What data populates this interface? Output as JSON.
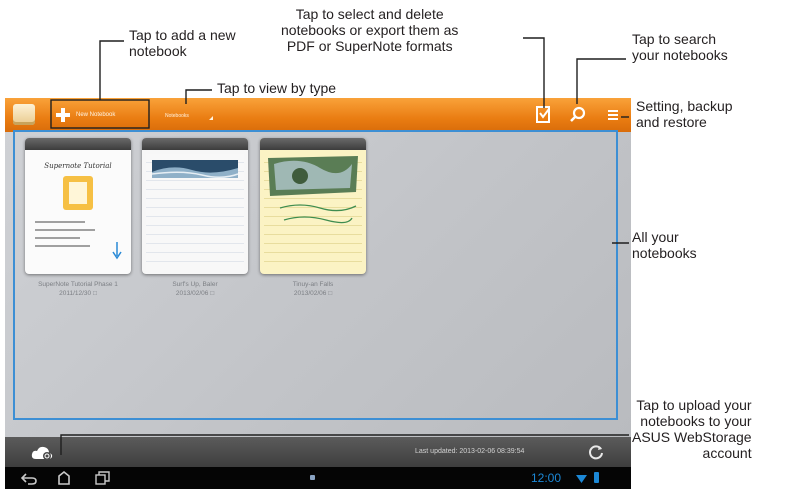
{
  "callouts": {
    "new_notebook": "Tap to add a new\nnotebook",
    "view_type": "Tap to view by type",
    "select_export": "Tap to select and delete\nnotebooks or export them as\nPDF or SuperNote formats",
    "search": "Tap to search\nyour notebooks",
    "settings": "Setting, backup\nand restore",
    "all_notebooks": "All your\nnotebooks",
    "upload": "Tap to upload your\nnotebooks to your\nASUS WebStorage\naccount"
  },
  "toolbar": {
    "new_notebook_label": "New Notebook",
    "view_type_label": "Notebooks",
    "icons": [
      "notebook-app-icon",
      "plus-icon",
      "select-export-icon",
      "search-icon",
      "settings-icon"
    ],
    "accent_color": "#f0860f"
  },
  "notebooks": [
    {
      "title": "SuperNote Tutorial Phase 1",
      "date": "2011/12/30"
    },
    {
      "title": "Surf's Up, Baler",
      "date": "2013/02/06"
    },
    {
      "title": "Tinuy-an Falls",
      "date": "2013/02/06"
    }
  ],
  "bottom_bar": {
    "last_updated": "Last updated: 2013-02-06 08:39:54",
    "icons": [
      "cloud-upload-icon",
      "sync-icon"
    ]
  },
  "system_bar": {
    "clock": "12:00",
    "icons": [
      "back-icon",
      "home-icon",
      "recent-apps-icon",
      "wifi-icon",
      "battery-icon"
    ],
    "clock_color": "#1c88d6"
  },
  "highlight_color": "#3d8fd4"
}
